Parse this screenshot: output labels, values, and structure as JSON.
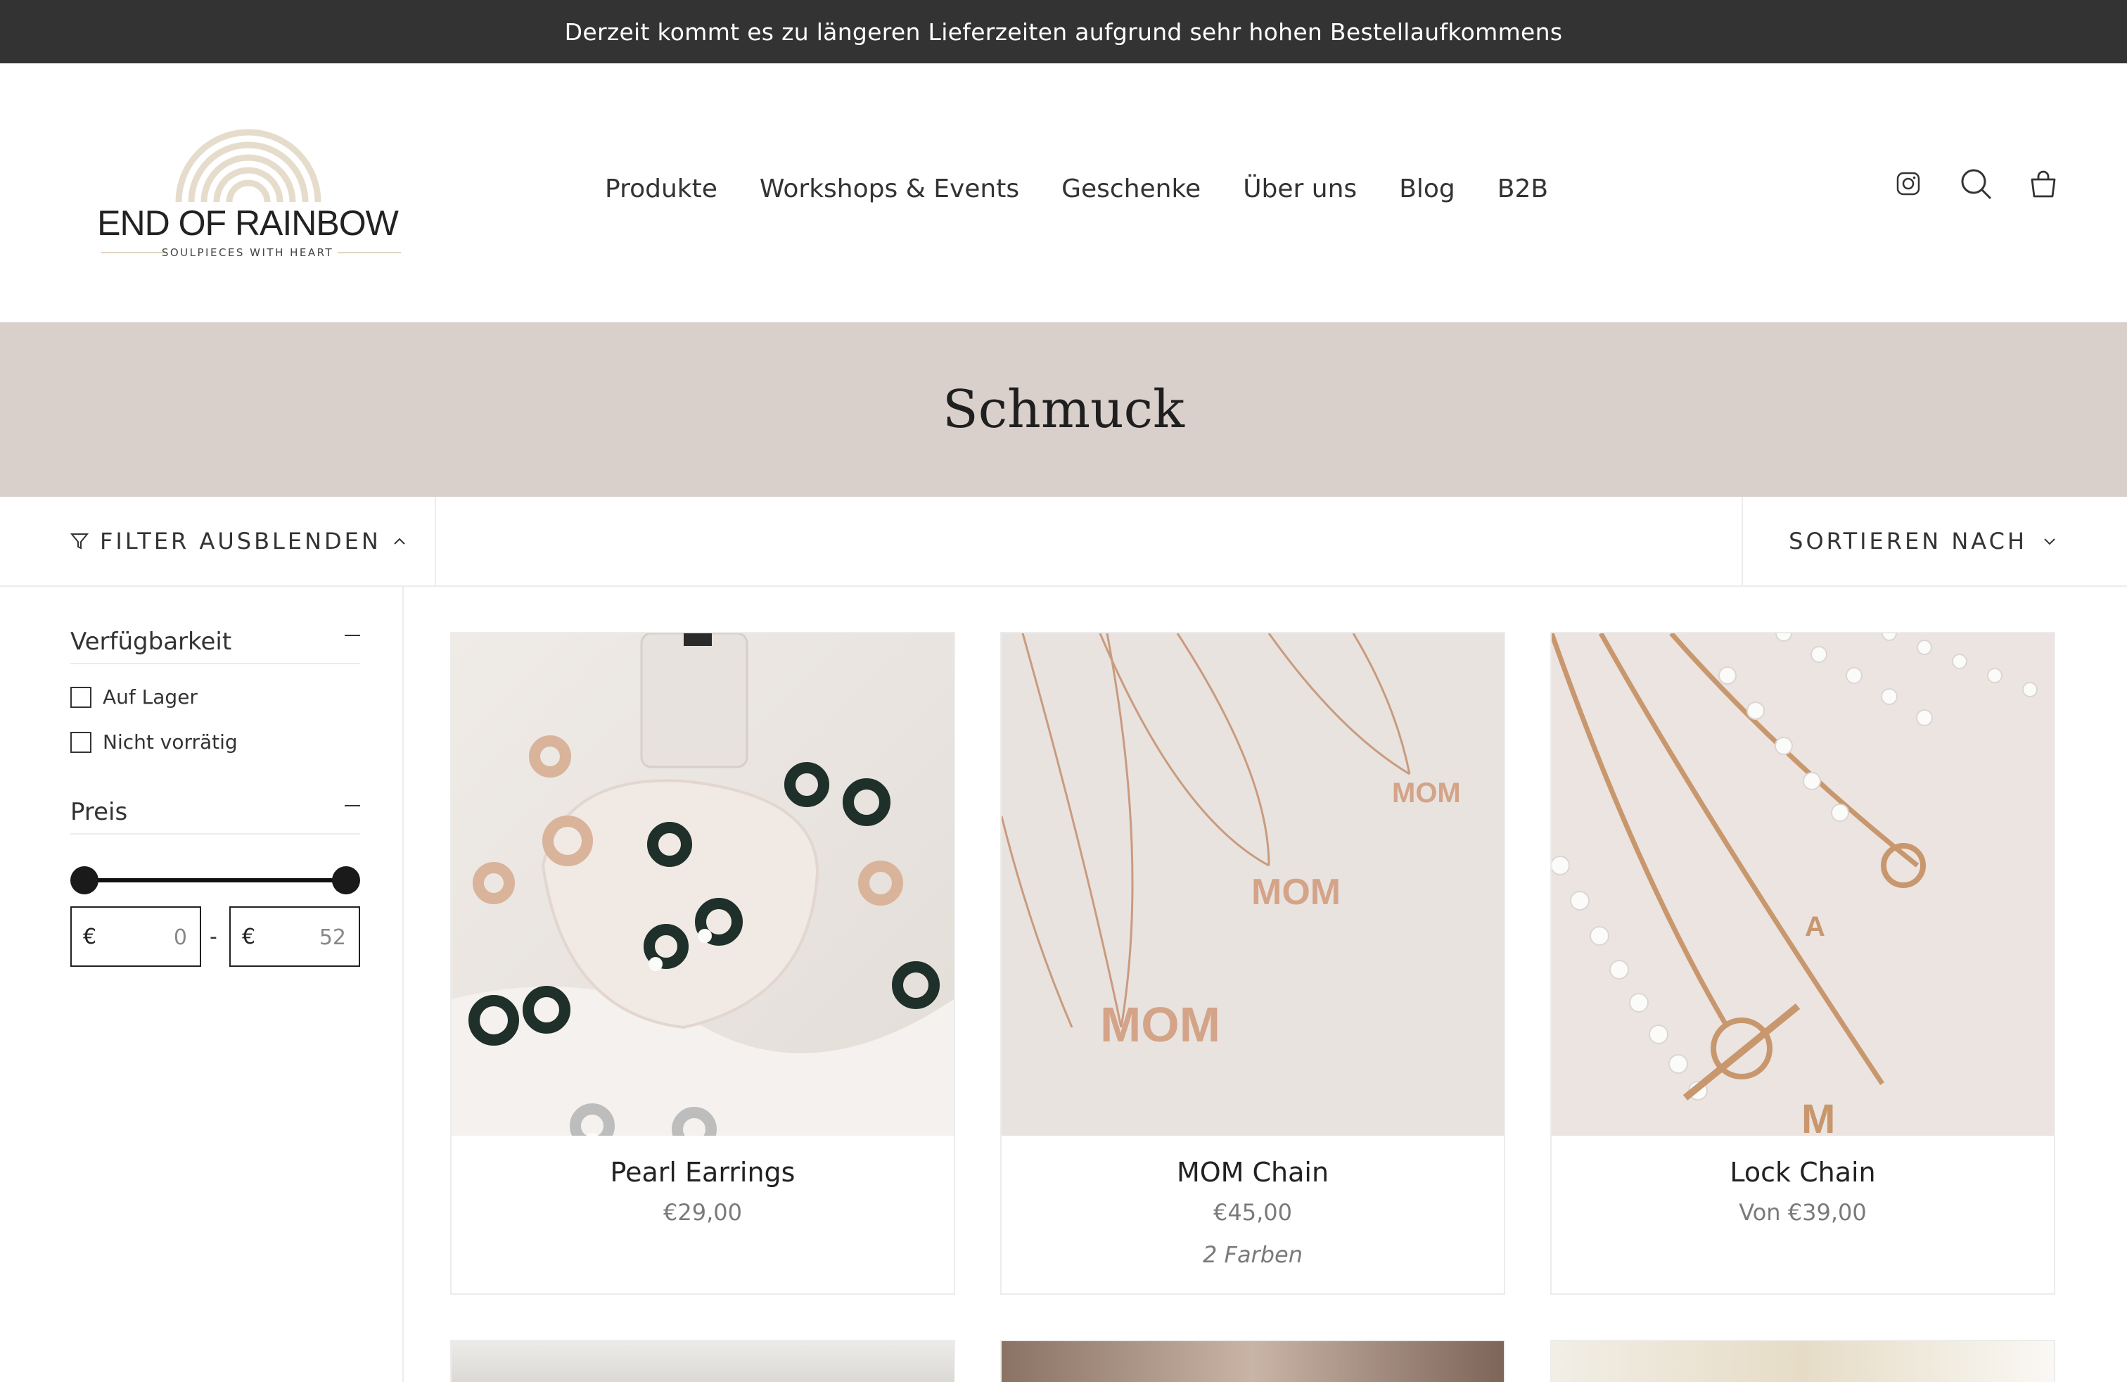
{
  "announcement": "Derzeit kommt es zu längeren Lieferzeiten aufgrund sehr hohen Bestellaufkommens",
  "logo": {
    "title": "END OF RAINBOW",
    "subtitle": "SOULPIECES WITH HEART"
  },
  "nav": [
    "Produkte",
    "Workshops & Events",
    "Geschenke",
    "Über uns",
    "Blog",
    "B2B"
  ],
  "header_icons": [
    "instagram-icon",
    "search-icon",
    "cart-icon"
  ],
  "page_title": "Schmuck",
  "filter_bar": {
    "toggle_label": "FILTER AUSBLENDEN",
    "sort_label": "SORTIEREN NACH"
  },
  "filters": {
    "availability": {
      "title": "Verfügbarkeit",
      "options": [
        "Auf Lager",
        "Nicht vorrätig"
      ]
    },
    "price": {
      "title": "Preis",
      "currency": "€",
      "min": "0",
      "max": "52",
      "range_low": 0,
      "range_high": 52
    }
  },
  "products": [
    {
      "name": "Pearl Earrings",
      "price": "€29,00",
      "variants": ""
    },
    {
      "name": "MOM Chain",
      "price": "€45,00",
      "variants": "2 Farben"
    },
    {
      "name": "Lock Chain",
      "price": "Von €39,00",
      "variants": ""
    }
  ],
  "colors": {
    "announcement_bg": "#333333",
    "band_bg": "#d9d0cc",
    "accent_logo": "#e2d6c3"
  }
}
